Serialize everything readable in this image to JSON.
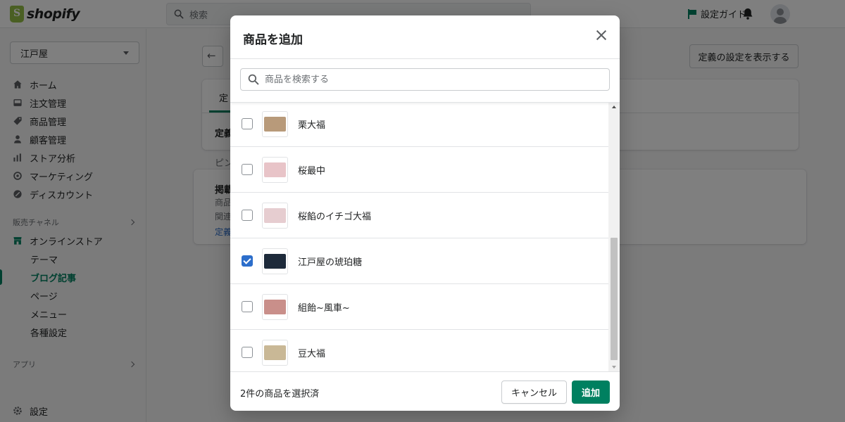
{
  "topbar": {
    "logo_text": "shopify",
    "search_placeholder": "検索",
    "setup_guide_label": "設定ガイド"
  },
  "sidebar": {
    "store_name": "江戸屋",
    "items": [
      {
        "label": "ホーム",
        "icon": "home-icon"
      },
      {
        "label": "注文管理",
        "icon": "inbox-icon"
      },
      {
        "label": "商品管理",
        "icon": "tag-icon"
      },
      {
        "label": "顧客管理",
        "icon": "person-icon"
      },
      {
        "label": "ストア分析",
        "icon": "bar-chart-icon"
      },
      {
        "label": "マーケティング",
        "icon": "target-icon"
      },
      {
        "label": "ディスカウント",
        "icon": "discount-icon"
      }
    ],
    "sales_channel_label": "販売チャネル",
    "online_store_label": "オンラインストア",
    "online_store_subitems": [
      {
        "label": "テーマ",
        "active": false
      },
      {
        "label": "ブログ記事",
        "active": true
      },
      {
        "label": "ページ",
        "active": false
      },
      {
        "label": "メニュー",
        "active": false
      },
      {
        "label": "各種設定",
        "active": false
      }
    ],
    "apps_label": "アプリ",
    "settings_label": "設定"
  },
  "main": {
    "definition_button_label": "定義の設定を表示する",
    "partial_texts": [
      "定",
      "定義",
      "ピン",
      "掲載",
      "商品",
      "関連",
      "定義"
    ]
  },
  "modal": {
    "title": "商品を追加",
    "search_placeholder": "商品を検索する",
    "products": [
      {
        "name": "栗大福",
        "checked": false,
        "thumb_color": "#b89a7a"
      },
      {
        "name": "桜最中",
        "checked": false,
        "thumb_color": "#e8c4c8"
      },
      {
        "name": "桜餡のイチゴ大福",
        "checked": false,
        "thumb_color": "#e6cdd0"
      },
      {
        "name": "江戸屋の琥珀糖",
        "checked": true,
        "thumb_color": "#1d2a3a"
      },
      {
        "name": "組飴~風車~",
        "checked": false,
        "thumb_color": "#c98f8a"
      },
      {
        "name": "豆大福",
        "checked": false,
        "thumb_color": "#c9b896"
      }
    ],
    "selected_count_text": "2件の商品を選択済",
    "cancel_label": "キャンセル",
    "add_label": "追加"
  },
  "colors": {
    "primary_green": "#008060",
    "checkbox_blue": "#2c6ecb"
  }
}
